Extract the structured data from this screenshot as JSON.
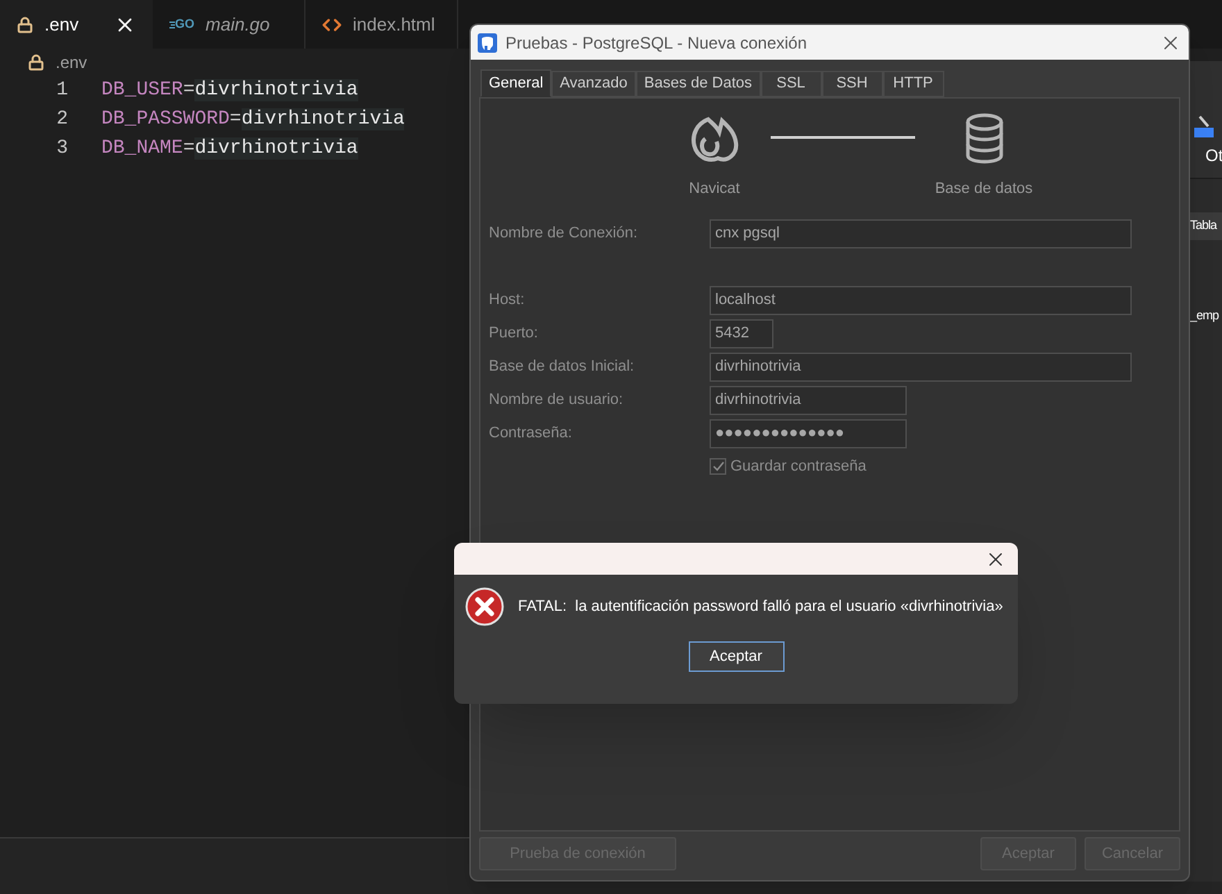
{
  "editor": {
    "tabs": [
      {
        "label": ".env",
        "kind": "lock",
        "selected": true,
        "preview": false
      },
      {
        "label": "main.go",
        "kind": "go",
        "icon_text": "GO",
        "selected": false,
        "preview": true
      },
      {
        "label": "index.html",
        "kind": "html",
        "selected": false,
        "preview": false
      }
    ],
    "breadcrumb": ".env",
    "lines": [
      {
        "number": "1",
        "key": "DB_USER",
        "operator": "=",
        "value": "divrhinotrivia"
      },
      {
        "number": "2",
        "key": "DB_PASSWORD",
        "operator": "=",
        "value": "divrhinotrivia"
      },
      {
        "number": "3",
        "key": "DB_NAME",
        "operator": "=",
        "value": "divrhinotrivia"
      }
    ]
  },
  "background_app": {
    "toolbar_label": "Ot",
    "table_header": "Tabla",
    "row_text": "_emp"
  },
  "dialog": {
    "title": "Pruebas - PostgreSQL - Nueva conexión",
    "tabs": [
      {
        "label": "General",
        "selected": true
      },
      {
        "label": "Avanzado",
        "selected": false
      },
      {
        "label": "Bases de Datos",
        "selected": false
      },
      {
        "label": "SSL",
        "selected": false
      },
      {
        "label": "SSH",
        "selected": false
      },
      {
        "label": "HTTP",
        "selected": false
      }
    ],
    "diagram": {
      "left_label": "Navicat",
      "right_label": "Base de datos"
    },
    "connection_name": {
      "label": "Nombre de Conexión:",
      "value": "cnx pgsql"
    },
    "fields": [
      {
        "label": "Host:",
        "value": "localhost",
        "kind": "wide"
      },
      {
        "label": "Puerto:",
        "value": "5432",
        "kind": "port"
      },
      {
        "label": "Base de datos Inicial:",
        "value": "divrhinotrivia",
        "kind": "wide"
      },
      {
        "label": "Nombre de usuario:",
        "value": "divrhinotrivia",
        "kind": "medium"
      },
      {
        "label": "Contraseña:",
        "value": "●●●●●●●●●●●●●●",
        "kind": "medium"
      }
    ],
    "save_password": {
      "label": "Guardar contraseña",
      "checked": true
    },
    "footer_buttons": [
      {
        "label": "Prueba de conexión",
        "kind": "left"
      },
      {
        "label": "Aceptar",
        "kind": "right"
      },
      {
        "label": "Cancelar",
        "kind": "right"
      }
    ]
  },
  "error": {
    "message": "FATAL:  la autentificación password falló para el usuario «divrhinotrivia»",
    "button": "Aceptar"
  }
}
